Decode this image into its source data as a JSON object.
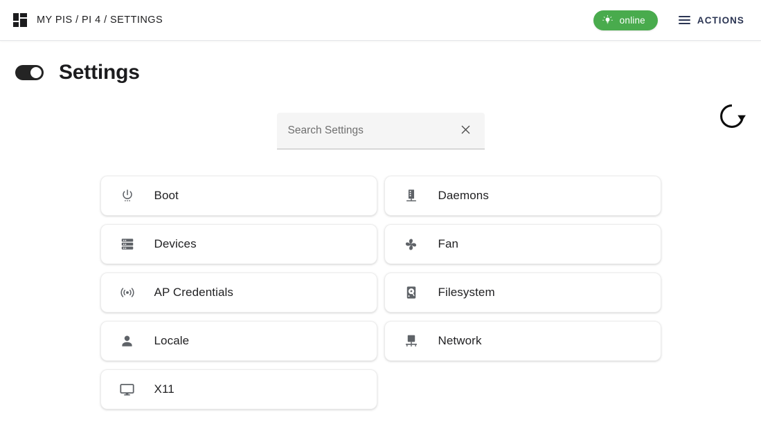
{
  "topbar": {
    "menu_icon": "grid-dashboard-icon",
    "breadcrumb": "MY PIS / PI 4 / SETTINGS",
    "status": {
      "label": "online",
      "icon": "lightbulb-icon",
      "color": "#49ab4d"
    },
    "actions": {
      "label": "ACTIONS",
      "icon": "hamburger-menu-icon",
      "color": "#2b3553"
    }
  },
  "pagehead": {
    "toggle": {
      "name": "advanced-toggle",
      "state": "on"
    },
    "title": "Settings",
    "refresh": {
      "label": "",
      "icon": "refresh-icon"
    }
  },
  "search": {
    "placeholder": "Search Settings",
    "value": "",
    "clear_icon": "close-icon"
  },
  "tiles": [
    {
      "label": "Boot",
      "icon": "power-settings-icon"
    },
    {
      "label": "Daemons",
      "icon": "server-tower-icon"
    },
    {
      "label": "Devices",
      "icon": "storage-stack-icon"
    },
    {
      "label": "Fan",
      "icon": "fan-blades-icon"
    },
    {
      "label": "AP Credentials",
      "icon": "broadcast-rss-icon"
    },
    {
      "label": "Filesystem",
      "icon": "hard-disk-icon"
    },
    {
      "label": "Locale",
      "icon": "person-icon"
    },
    {
      "label": "Network",
      "icon": "network-computer-icon"
    },
    {
      "label": "X11",
      "icon": "monitor-icon"
    }
  ]
}
